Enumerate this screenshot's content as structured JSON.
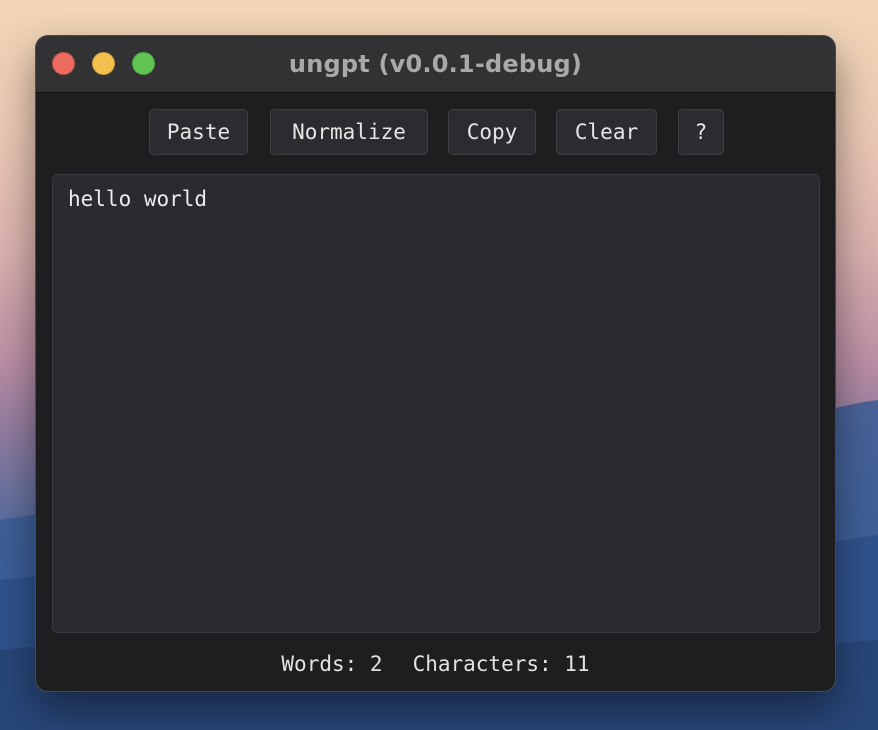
{
  "window": {
    "title": "ungpt (v0.0.1-debug)"
  },
  "toolbar": {
    "paste_label": "Paste",
    "normalize_label": "Normalize",
    "copy_label": "Copy",
    "clear_label": "Clear",
    "help_label": "?"
  },
  "editor": {
    "text": "hello world"
  },
  "status": {
    "words": "Words: 2",
    "characters": "Characters: 11"
  },
  "colors": {
    "close": "#ed6a5e",
    "minimize": "#f4bf4f",
    "maximize": "#61c554",
    "window_bg": "#1e1e21",
    "editor_bg": "#2a2a30"
  }
}
